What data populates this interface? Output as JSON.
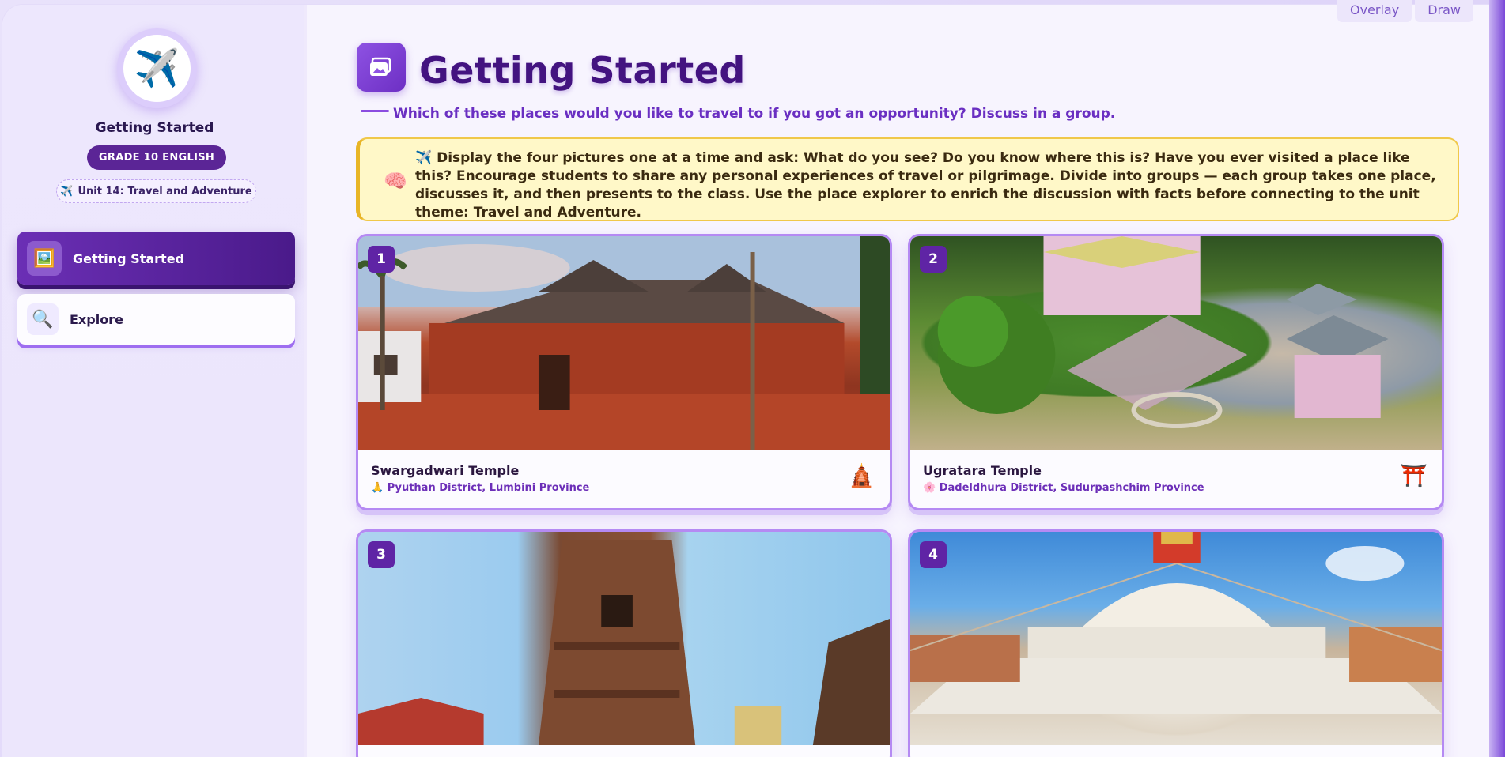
{
  "top_tools": [
    "Overlay",
    "Draw"
  ],
  "sidebar": {
    "title": "Getting Started",
    "grade": "GRADE 10 ENGLISH",
    "unit": "Unit 14: Travel and Adventure",
    "unit_icon": "✈️",
    "avatar_icon": "✈️",
    "nav": [
      {
        "label": "Getting Started",
        "icon": "🖼️",
        "active": true
      },
      {
        "label": "Explore",
        "icon": "🔍",
        "active": false
      }
    ]
  },
  "main": {
    "title": "Getting Started",
    "subtitle": "Which of these places would you like to travel to if you got an opportunity? Discuss in a group.",
    "note_icon": "🧠",
    "note": "✈️ Display the four pictures one at a time and ask: What do you see? Do you know where this is? Have you ever visited a place like this? Encourage students to share any personal experiences of travel or pilgrimage. Divide into groups — each group takes one place, discusses it, and then presents to the class. Use the place explorer to enrich the discussion with facts before connecting to the unit theme: Travel and Adventure.",
    "cards": [
      {
        "num": "1",
        "name": "Swargadwari Temple",
        "loc_icon": "🙏",
        "location": "Pyuthan District, Lumbini Province",
        "emblem": "🛕"
      },
      {
        "num": "2",
        "name": "Ugratara Temple",
        "loc_icon": "🌸",
        "location": "Dadeldhura District, Sudurpashchim Province",
        "emblem": "⛩️"
      },
      {
        "num": "3"
      },
      {
        "num": "4"
      }
    ]
  }
}
